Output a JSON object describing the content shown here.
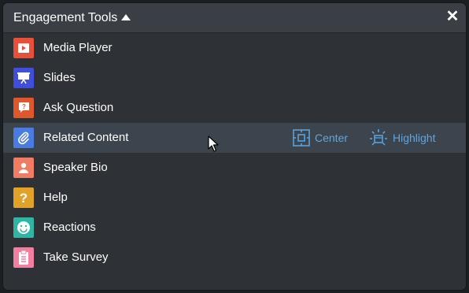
{
  "header": {
    "title": "Engagement Tools",
    "caret_icon": "caret-up-icon",
    "close_icon": "close-icon"
  },
  "items": [
    {
      "label": "Media Player",
      "icon": "play-icon",
      "color": "#e8503a"
    },
    {
      "label": "Slides",
      "icon": "presentation-icon",
      "color": "#3f4fdb"
    },
    {
      "label": "Ask Question",
      "icon": "question-bubble-icon",
      "color": "#e0572b"
    },
    {
      "label": "Related Content",
      "icon": "paperclip-icon",
      "color": "#4a7be0",
      "highlighted": true
    },
    {
      "label": "Speaker Bio",
      "icon": "person-icon",
      "color": "#f07d63"
    },
    {
      "label": "Help",
      "icon": "question-mark-icon",
      "color": "#e2a22a"
    },
    {
      "label": "Reactions",
      "icon": "smiley-icon",
      "color": "#2fb5a5"
    },
    {
      "label": "Take Survey",
      "icon": "clipboard-icon",
      "color": "#f17fa0"
    }
  ],
  "row_actions": {
    "center_label": "Center",
    "center_icon": "center-target-icon",
    "highlight_label": "Highlight",
    "highlight_icon": "highlight-icon"
  },
  "colors": {
    "panel_bg": "#2e3236",
    "header_bg": "#3a3f45",
    "highlight_row_bg": "#3c454d",
    "action_blue": "#5aa6e6"
  }
}
